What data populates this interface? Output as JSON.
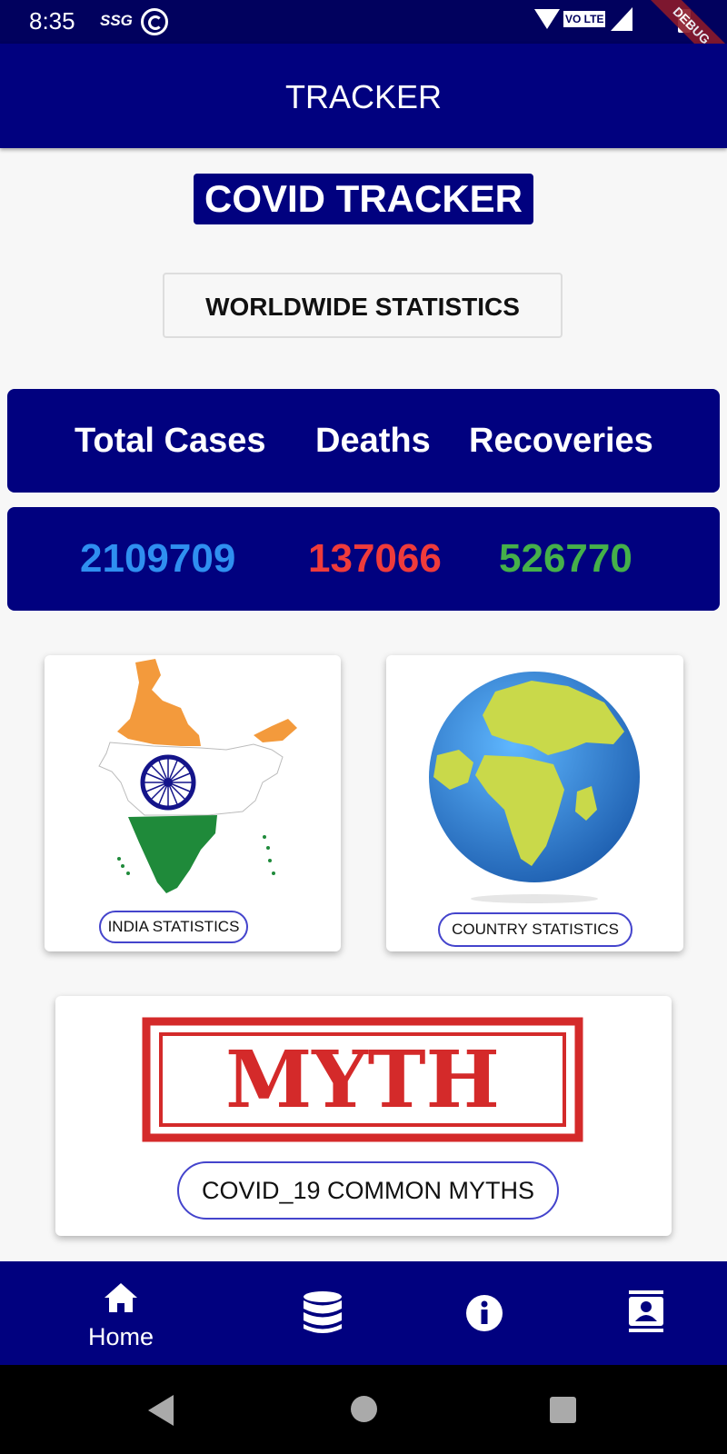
{
  "status_bar": {
    "time": "8:35",
    "carrier_label": "SSG",
    "volte_label": "VO LTE",
    "debug_banner": "DEBUG"
  },
  "app_bar": {
    "title": "TRACKER"
  },
  "header": {
    "title": "COVID TRACKER"
  },
  "worldwide_button": {
    "label": "WORLDWIDE STATISTICS"
  },
  "stats": {
    "labels": [
      "Total Cases",
      "Deaths",
      "Recoveries"
    ],
    "values": [
      "2109709",
      "137066",
      "526770"
    ],
    "colors": {
      "total": "#2f8ff0",
      "deaths": "#ef3b3b",
      "recoveries": "#45b04a"
    }
  },
  "cards": {
    "india": {
      "label": "INDIA STATISTICS",
      "icon": "india-map-flag-icon"
    },
    "country": {
      "label": "COUNTRY STATISTICS",
      "icon": "globe-icon"
    },
    "myths": {
      "label": "COVID_19 COMMON MYTHS",
      "stamp_text": "MYTH"
    }
  },
  "bottom_nav": {
    "items": [
      {
        "label": "Home",
        "icon": "home-icon",
        "active": true
      },
      {
        "label": "",
        "icon": "database-icon",
        "active": false
      },
      {
        "label": "",
        "icon": "info-icon",
        "active": false
      },
      {
        "label": "",
        "icon": "contacts-icon",
        "active": false
      }
    ]
  },
  "colors": {
    "primary": "#01017f",
    "status_bar": "#01015e"
  }
}
